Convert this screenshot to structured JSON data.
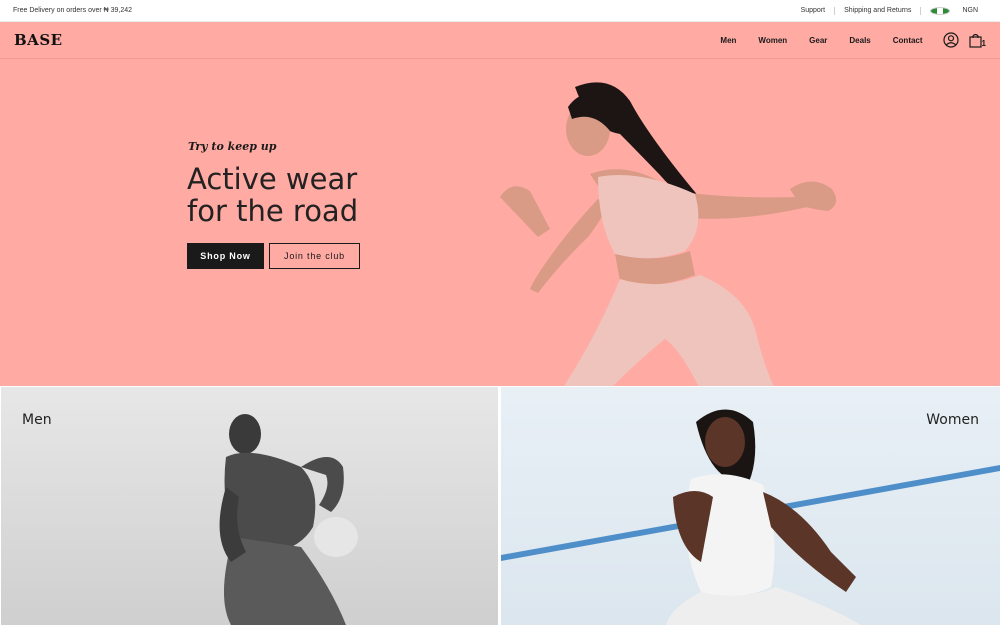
{
  "topbar": {
    "promo": "Free Delivery on orders over  ₦ 39,242",
    "support": "Support",
    "shipping": "Shipping and Returns",
    "currency": "NGN"
  },
  "header": {
    "logo": "BASE",
    "nav": [
      "Men",
      "Women",
      "Gear",
      "Deals",
      "Contact"
    ],
    "cart_count": "1"
  },
  "hero": {
    "tagline": "Try to keep up",
    "headline_line1": "Active wear",
    "headline_line2": "for the road",
    "primary_cta": "Shop Now",
    "secondary_cta": "Join the club"
  },
  "categories": [
    {
      "label": "Men"
    },
    {
      "label": "Women"
    }
  ],
  "colors": {
    "brand_pink": "#ffaaa3",
    "dark": "#1a1a1a"
  }
}
